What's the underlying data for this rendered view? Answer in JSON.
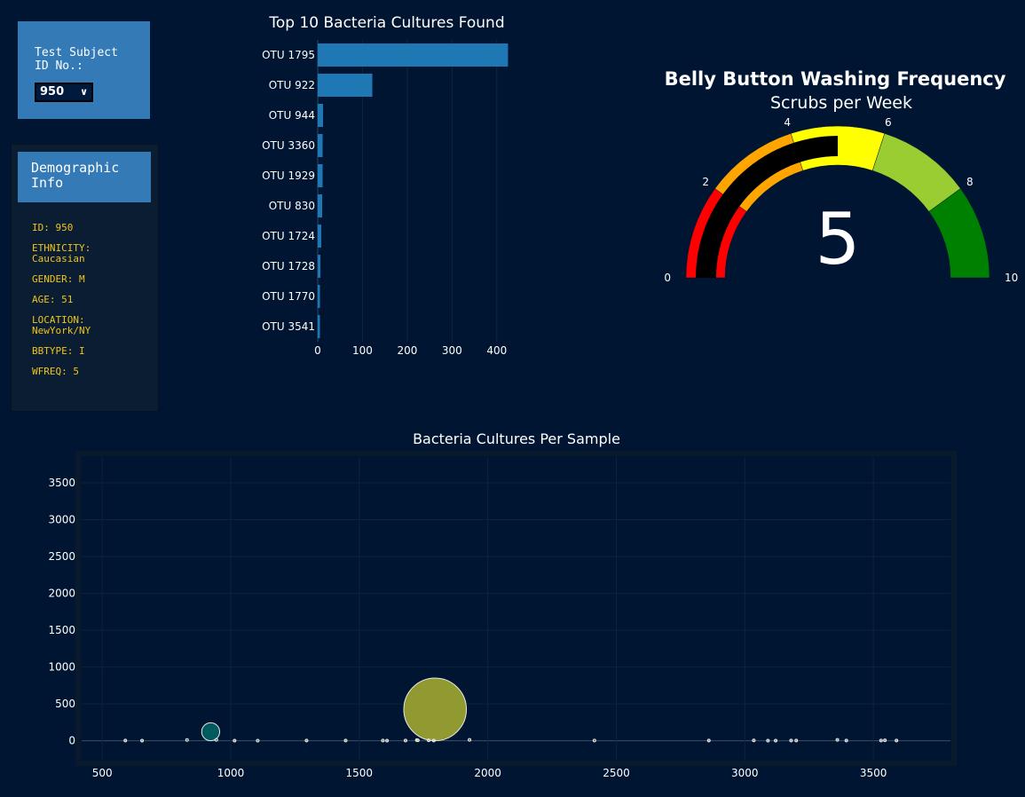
{
  "selector": {
    "label": "Test Subject\nID No.:",
    "value": "950"
  },
  "demographic": {
    "title": "Demographic\nInfo",
    "rows": [
      "ID: 950",
      "ETHNICITY:\nCaucasian",
      "GENDER: M",
      "AGE: 51",
      "LOCATION:\nNewYork/NY",
      "BBTYPE: I",
      "WFREQ: 5"
    ]
  },
  "chart_data": [
    {
      "type": "bar",
      "orientation": "horizontal",
      "title": "Top 10 Bacteria Cultures Found",
      "categories": [
        "OTU 1795",
        "OTU 922",
        "OTU 944",
        "OTU 3360",
        "OTU 1929",
        "OTU 830",
        "OTU 1724",
        "OTU 1728",
        "OTU 1770",
        "OTU 3541"
      ],
      "values": [
        425,
        122,
        12,
        11,
        11,
        10,
        8,
        6,
        5,
        5
      ],
      "xlim": [
        0,
        440
      ],
      "xticks": [
        0,
        100,
        200,
        300,
        400
      ],
      "color": "#1f77b4"
    },
    {
      "type": "gauge",
      "title": "Belly Button Washing Frequency",
      "subtitle": "Scrubs per Week",
      "value": 5,
      "range": [
        0,
        10
      ],
      "ticks": [
        0,
        2,
        4,
        6,
        8,
        10
      ],
      "steps": [
        {
          "range": [
            0,
            2
          ],
          "color": "#ff0000"
        },
        {
          "range": [
            2,
            4
          ],
          "color": "#ffa500"
        },
        {
          "range": [
            4,
            6
          ],
          "color": "#ffff00"
        },
        {
          "range": [
            6,
            8
          ],
          "color": "#9acd32"
        },
        {
          "range": [
            8,
            10
          ],
          "color": "#008000"
        }
      ],
      "bar_color": "#000000"
    },
    {
      "type": "scatter",
      "title": "Bacteria Cultures Per Sample",
      "xlim": [
        420,
        3800
      ],
      "ylim": [
        -270,
        3850
      ],
      "xticks": [
        500,
        1000,
        1500,
        2000,
        2500,
        3000,
        3500
      ],
      "yticks": [
        0,
        500,
        1000,
        1500,
        2000,
        2500,
        3000,
        3500
      ],
      "points": [
        {
          "x": 1795,
          "y": 425,
          "s": 425,
          "color": "#a0a830"
        },
        {
          "x": 922,
          "y": 122,
          "s": 122,
          "color": "#00897b"
        },
        {
          "x": 590,
          "y": 2,
          "s": 2,
          "color": "#cfcfcf"
        },
        {
          "x": 655,
          "y": 1,
          "s": 1,
          "color": "#cfcfcf"
        },
        {
          "x": 830,
          "y": 10,
          "s": 10,
          "color": "#1aa3a3"
        },
        {
          "x": 944,
          "y": 12,
          "s": 12,
          "color": "#1aa39a"
        },
        {
          "x": 1015,
          "y": 1,
          "s": 1,
          "color": "#cfcfcf"
        },
        {
          "x": 1105,
          "y": 1,
          "s": 1,
          "color": "#4ebf88"
        },
        {
          "x": 1295,
          "y": 2,
          "s": 2,
          "color": "#c6d650"
        },
        {
          "x": 1447,
          "y": 2,
          "s": 2,
          "color": "#d0dc55"
        },
        {
          "x": 1592,
          "y": 2,
          "s": 2,
          "color": "#b0b96a"
        },
        {
          "x": 1608,
          "y": 1,
          "s": 1,
          "color": "#cfcfcf"
        },
        {
          "x": 1680,
          "y": 2,
          "s": 2,
          "color": "#cfd06a"
        },
        {
          "x": 1724,
          "y": 8,
          "s": 8,
          "color": "#c9d24d"
        },
        {
          "x": 1728,
          "y": 6,
          "s": 6,
          "color": "#b8bf50"
        },
        {
          "x": 1770,
          "y": 5,
          "s": 5,
          "color": "#c0c45a"
        },
        {
          "x": 1790,
          "y": 3,
          "s": 3,
          "color": "#cfcfcf"
        },
        {
          "x": 1929,
          "y": 11,
          "s": 11,
          "color": "#b3b032"
        },
        {
          "x": 2415,
          "y": 3,
          "s": 3,
          "color": "#b07a66"
        },
        {
          "x": 2860,
          "y": 2,
          "s": 2,
          "color": "#cfcfcf"
        },
        {
          "x": 3035,
          "y": 4,
          "s": 4,
          "color": "#cfcfcf"
        },
        {
          "x": 3090,
          "y": 1,
          "s": 1,
          "color": "#cfcfcf"
        },
        {
          "x": 3120,
          "y": 1,
          "s": 1,
          "color": "#cfcfcf"
        },
        {
          "x": 3180,
          "y": 2,
          "s": 2,
          "color": "#cfcfcf"
        },
        {
          "x": 3200,
          "y": 2,
          "s": 2,
          "color": "#cfcfcf"
        },
        {
          "x": 3360,
          "y": 11,
          "s": 11,
          "color": "#cfcfcf"
        },
        {
          "x": 3395,
          "y": 3,
          "s": 3,
          "color": "#cfcfcf"
        },
        {
          "x": 3530,
          "y": 3,
          "s": 3,
          "color": "#cfcfcf"
        },
        {
          "x": 3545,
          "y": 5,
          "s": 5,
          "color": "#cfcfcf"
        },
        {
          "x": 3590,
          "y": 3,
          "s": 3,
          "color": "#cfcfcf"
        }
      ]
    }
  ]
}
